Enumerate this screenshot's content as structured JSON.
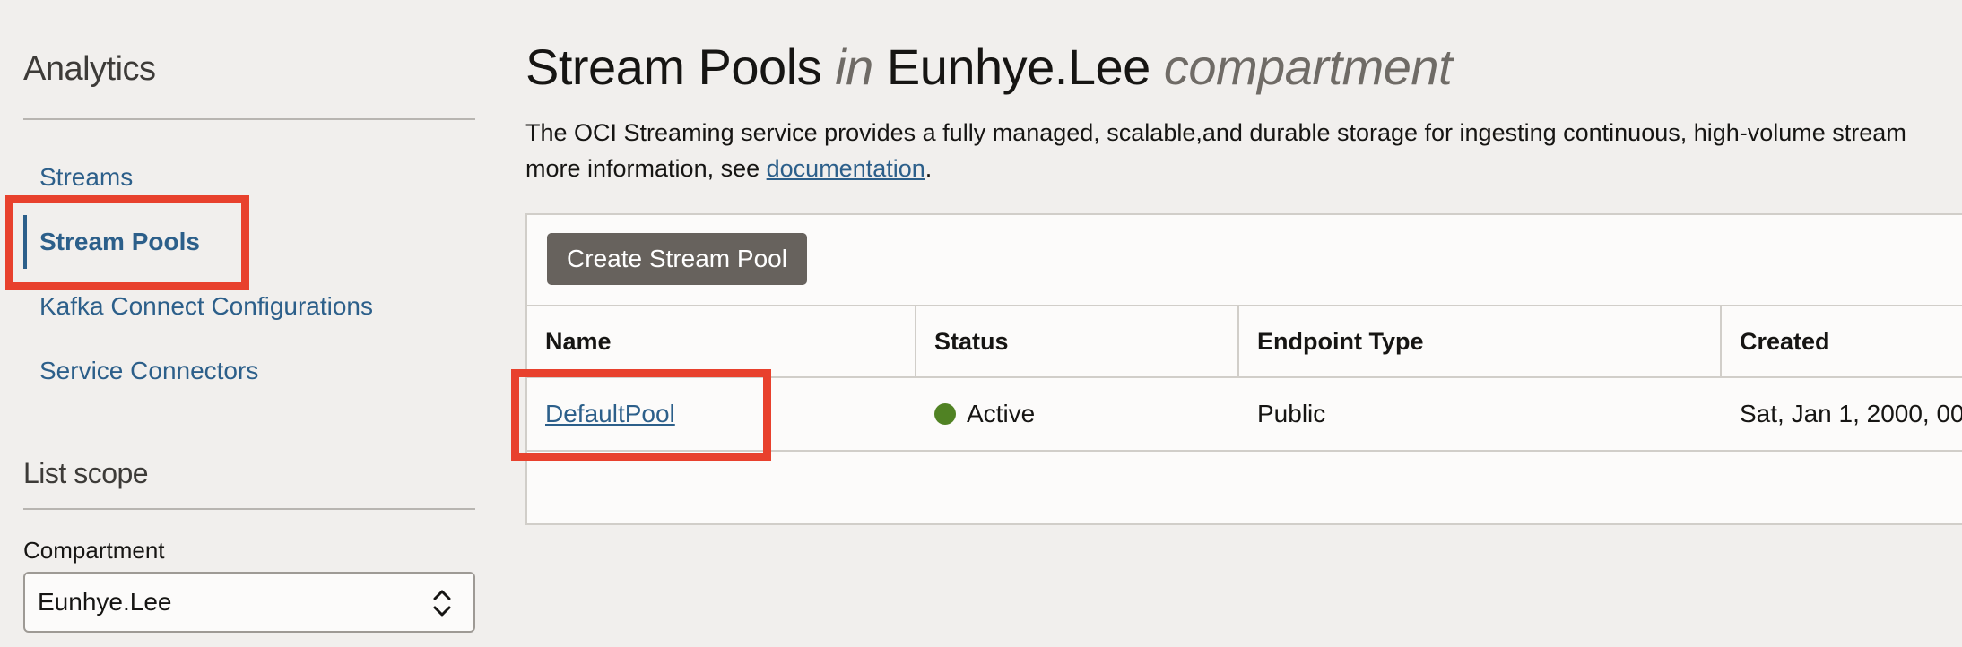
{
  "sidebar": {
    "heading": "Analytics",
    "items": [
      {
        "label": "Streams"
      },
      {
        "label": "Stream Pools",
        "active": true
      },
      {
        "label": "Kafka Connect Configurations"
      },
      {
        "label": "Service Connectors"
      }
    ],
    "scope_heading": "List scope",
    "compartment_label": "Compartment",
    "compartment_value": "Eunhye.Lee"
  },
  "header": {
    "title_main": "Stream Pools",
    "title_in": "in",
    "title_compartment": "Eunhye.Lee",
    "title_suffix": "compartment",
    "description_line1": "The OCI Streaming service provides a fully managed, scalable,and durable storage for ingesting continuous, high-volume stream",
    "description_line2_prefix": "more information, see",
    "description_link": "documentation",
    "description_line2_suffix": "."
  },
  "toolbar": {
    "create_label": "Create Stream Pool"
  },
  "table": {
    "columns": [
      "Name",
      "Status",
      "Endpoint Type",
      "Created"
    ],
    "rows": [
      {
        "name": "DefaultPool",
        "status": "Active",
        "endpoint_type": "Public",
        "created": "Sat, Jan 1, 2000, 00"
      }
    ]
  },
  "colors": {
    "link": "#2c5f8a",
    "highlight": "#e8412d",
    "status_active": "#508223",
    "button_bg": "#67625d"
  },
  "icons": {
    "compartment_select": "chevron-up-down-icon",
    "status": "status-dot-icon"
  }
}
